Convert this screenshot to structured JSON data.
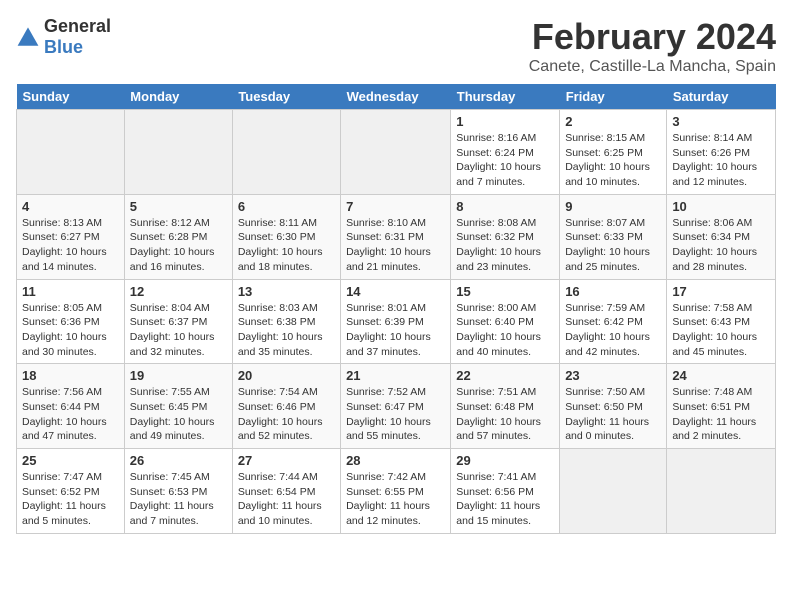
{
  "header": {
    "logo_general": "General",
    "logo_blue": "Blue",
    "title": "February 2024",
    "subtitle": "Canete, Castille-La Mancha, Spain"
  },
  "days_of_week": [
    "Sunday",
    "Monday",
    "Tuesday",
    "Wednesday",
    "Thursday",
    "Friday",
    "Saturday"
  ],
  "weeks": [
    [
      {
        "day": "",
        "info": ""
      },
      {
        "day": "",
        "info": ""
      },
      {
        "day": "",
        "info": ""
      },
      {
        "day": "",
        "info": ""
      },
      {
        "day": "1",
        "info": "Sunrise: 8:16 AM\nSunset: 6:24 PM\nDaylight: 10 hours and 7 minutes."
      },
      {
        "day": "2",
        "info": "Sunrise: 8:15 AM\nSunset: 6:25 PM\nDaylight: 10 hours and 10 minutes."
      },
      {
        "day": "3",
        "info": "Sunrise: 8:14 AM\nSunset: 6:26 PM\nDaylight: 10 hours and 12 minutes."
      }
    ],
    [
      {
        "day": "4",
        "info": "Sunrise: 8:13 AM\nSunset: 6:27 PM\nDaylight: 10 hours and 14 minutes."
      },
      {
        "day": "5",
        "info": "Sunrise: 8:12 AM\nSunset: 6:28 PM\nDaylight: 10 hours and 16 minutes."
      },
      {
        "day": "6",
        "info": "Sunrise: 8:11 AM\nSunset: 6:30 PM\nDaylight: 10 hours and 18 minutes."
      },
      {
        "day": "7",
        "info": "Sunrise: 8:10 AM\nSunset: 6:31 PM\nDaylight: 10 hours and 21 minutes."
      },
      {
        "day": "8",
        "info": "Sunrise: 8:08 AM\nSunset: 6:32 PM\nDaylight: 10 hours and 23 minutes."
      },
      {
        "day": "9",
        "info": "Sunrise: 8:07 AM\nSunset: 6:33 PM\nDaylight: 10 hours and 25 minutes."
      },
      {
        "day": "10",
        "info": "Sunrise: 8:06 AM\nSunset: 6:34 PM\nDaylight: 10 hours and 28 minutes."
      }
    ],
    [
      {
        "day": "11",
        "info": "Sunrise: 8:05 AM\nSunset: 6:36 PM\nDaylight: 10 hours and 30 minutes."
      },
      {
        "day": "12",
        "info": "Sunrise: 8:04 AM\nSunset: 6:37 PM\nDaylight: 10 hours and 32 minutes."
      },
      {
        "day": "13",
        "info": "Sunrise: 8:03 AM\nSunset: 6:38 PM\nDaylight: 10 hours and 35 minutes."
      },
      {
        "day": "14",
        "info": "Sunrise: 8:01 AM\nSunset: 6:39 PM\nDaylight: 10 hours and 37 minutes."
      },
      {
        "day": "15",
        "info": "Sunrise: 8:00 AM\nSunset: 6:40 PM\nDaylight: 10 hours and 40 minutes."
      },
      {
        "day": "16",
        "info": "Sunrise: 7:59 AM\nSunset: 6:42 PM\nDaylight: 10 hours and 42 minutes."
      },
      {
        "day": "17",
        "info": "Sunrise: 7:58 AM\nSunset: 6:43 PM\nDaylight: 10 hours and 45 minutes."
      }
    ],
    [
      {
        "day": "18",
        "info": "Sunrise: 7:56 AM\nSunset: 6:44 PM\nDaylight: 10 hours and 47 minutes."
      },
      {
        "day": "19",
        "info": "Sunrise: 7:55 AM\nSunset: 6:45 PM\nDaylight: 10 hours and 49 minutes."
      },
      {
        "day": "20",
        "info": "Sunrise: 7:54 AM\nSunset: 6:46 PM\nDaylight: 10 hours and 52 minutes."
      },
      {
        "day": "21",
        "info": "Sunrise: 7:52 AM\nSunset: 6:47 PM\nDaylight: 10 hours and 55 minutes."
      },
      {
        "day": "22",
        "info": "Sunrise: 7:51 AM\nSunset: 6:48 PM\nDaylight: 10 hours and 57 minutes."
      },
      {
        "day": "23",
        "info": "Sunrise: 7:50 AM\nSunset: 6:50 PM\nDaylight: 11 hours and 0 minutes."
      },
      {
        "day": "24",
        "info": "Sunrise: 7:48 AM\nSunset: 6:51 PM\nDaylight: 11 hours and 2 minutes."
      }
    ],
    [
      {
        "day": "25",
        "info": "Sunrise: 7:47 AM\nSunset: 6:52 PM\nDaylight: 11 hours and 5 minutes."
      },
      {
        "day": "26",
        "info": "Sunrise: 7:45 AM\nSunset: 6:53 PM\nDaylight: 11 hours and 7 minutes."
      },
      {
        "day": "27",
        "info": "Sunrise: 7:44 AM\nSunset: 6:54 PM\nDaylight: 11 hours and 10 minutes."
      },
      {
        "day": "28",
        "info": "Sunrise: 7:42 AM\nSunset: 6:55 PM\nDaylight: 11 hours and 12 minutes."
      },
      {
        "day": "29",
        "info": "Sunrise: 7:41 AM\nSunset: 6:56 PM\nDaylight: 11 hours and 15 minutes."
      },
      {
        "day": "",
        "info": ""
      },
      {
        "day": "",
        "info": ""
      }
    ]
  ]
}
